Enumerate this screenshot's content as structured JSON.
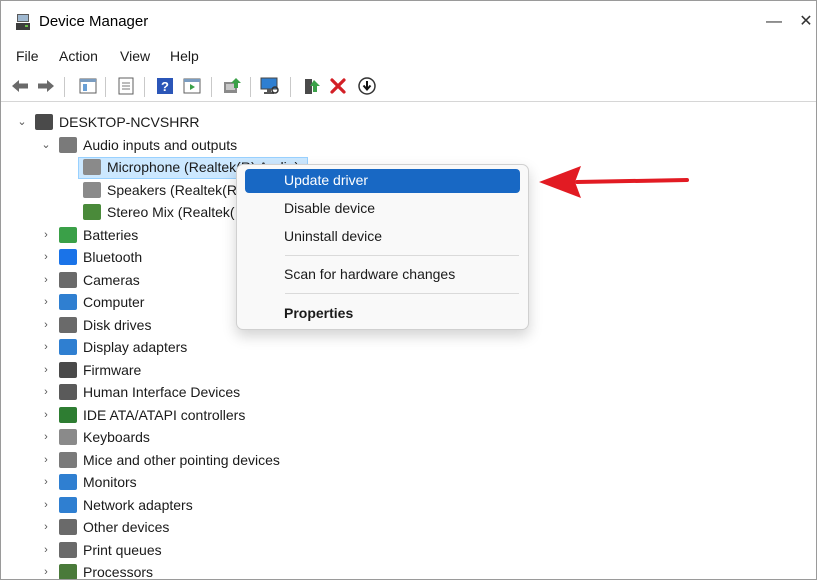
{
  "window": {
    "title": "Device Manager",
    "minimize": "—",
    "close": "✕"
  },
  "menu": [
    "File",
    "Action",
    "View",
    "Help"
  ],
  "toolbar": {
    "icons": [
      "back-arrow-icon",
      "forward-arrow-icon",
      "show-hide-tree-icon",
      "properties-icon",
      "help-icon",
      "action-pane-icon",
      "update-driver-icon",
      "scan-hardware-icon",
      "enable-device-icon",
      "uninstall-device-icon",
      "disable-device-icon"
    ]
  },
  "tree": {
    "root": "DESKTOP-NCVSHRR",
    "expanded_category": "Audio inputs and outputs",
    "children": [
      "Microphone (Realtek(R) Audio)",
      "Speakers (Realtek(R)",
      "Stereo Mix (Realtek("
    ],
    "categories": [
      "Batteries",
      "Bluetooth",
      "Cameras",
      "Computer",
      "Disk drives",
      "Display adapters",
      "Firmware",
      "Human Interface Devices",
      "IDE ATA/ATAPI controllers",
      "Keyboards",
      "Mice and other pointing devices",
      "Monitors",
      "Network adapters",
      "Other devices",
      "Print queues",
      "Processors"
    ]
  },
  "context_menu": {
    "update": "Update driver",
    "disable": "Disable device",
    "uninstall": "Uninstall device",
    "scan": "Scan for hardware changes",
    "properties": "Properties"
  },
  "colors": {
    "highlight": "#1868c4",
    "arrow": "#e21b23",
    "selection": "#cce8ff"
  }
}
